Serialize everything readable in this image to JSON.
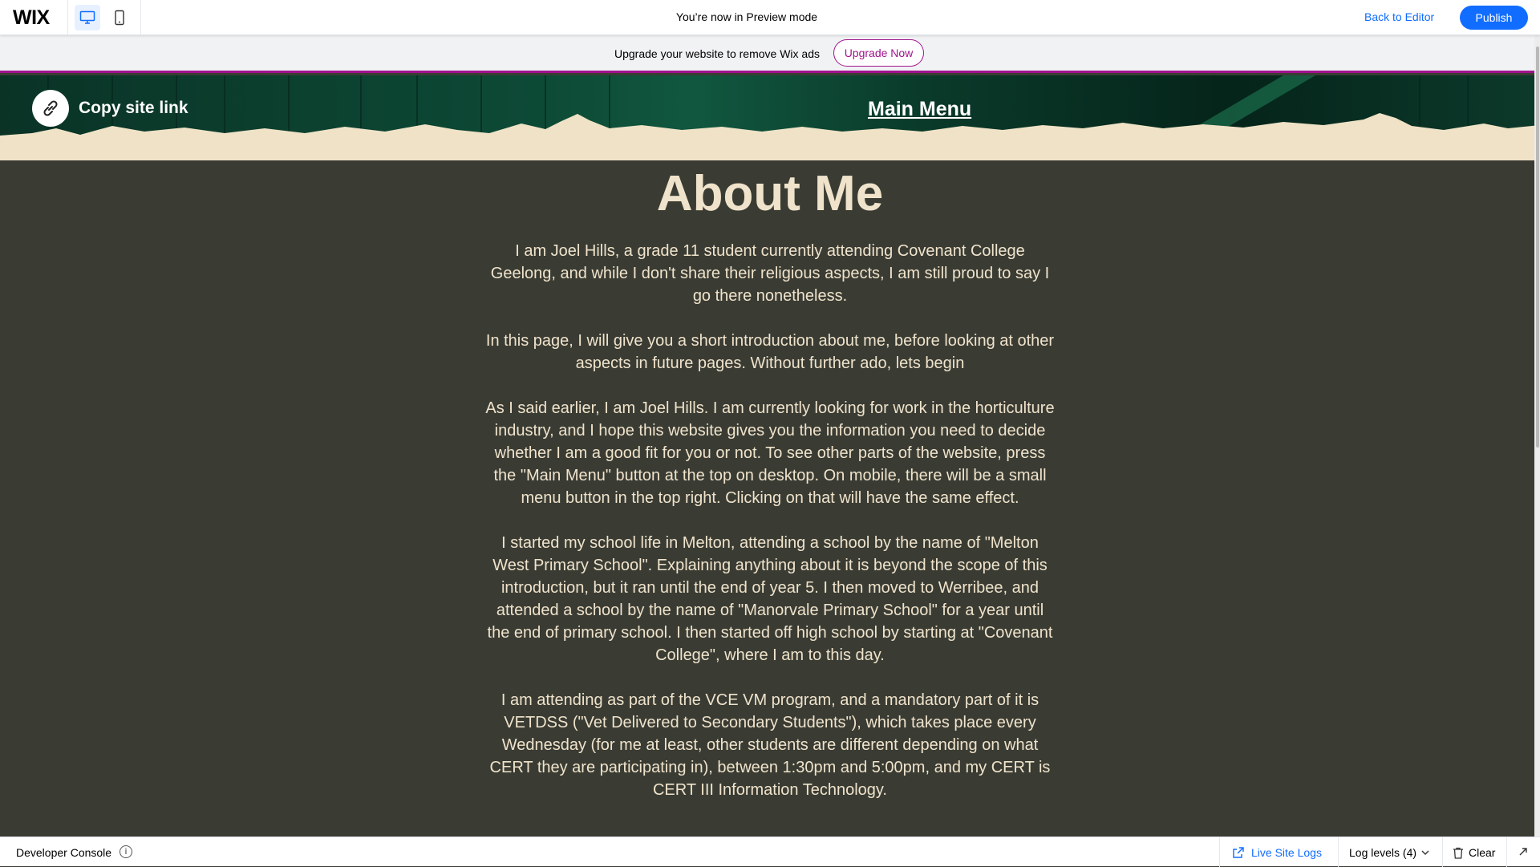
{
  "topbar": {
    "logo": "WIX",
    "preview_label": "You’re now in Preview mode",
    "back_to_editor": "Back to Editor",
    "publish": "Publish",
    "desktop_icon": "desktop-icon",
    "mobile_icon": "mobile-icon"
  },
  "upgrade": {
    "text": "Upgrade your website to remove Wix ads",
    "button": "Upgrade Now"
  },
  "site_header": {
    "copy_link": "Copy site link",
    "main_menu": "Main Menu"
  },
  "content": {
    "title": "About Me",
    "paragraphs": [
      "I am Joel Hills, a grade 11 student currently attending Covenant College Geelong, and while I don't share their religious aspects, I am still proud to say I go there nonetheless.",
      "In this page, I will give you a short introduction about me, before looking at other aspects in future pages. Without further ado, lets begin",
      "As I said earlier, I am Joel Hills. I am currently looking for work in the horticulture industry, and I hope this website gives you the information you need to decide whether I am a good fit for you or not. To see other parts of the website, press the \"Main Menu\" button at the top on desktop. On mobile, there will be a small menu button in the top right. Clicking on that will have the same effect.",
      "I started my school life in Melton, attending a school by the name of \"Melton West Primary School\". Explaining anything about it is beyond the scope of this introduction, but it ran until the end of year 5. I then moved to Werribee, and attended a school by the name of \"Manorvale Primary School\" for a year until the end of primary school. I then started off high school by starting at \"Covenant College\", where I am to this day.",
      "I am attending as part of the VCE VM program, and a mandatory part of it is VETDSS (\"Vet Delivered to Secondary Students\"), which takes place every Wednesday (for me at least, other students are different depending on what CERT they are participating in), between 1:30pm and 5:00pm, and my CERT is CERT III Information Technology."
    ]
  },
  "devconsole": {
    "title": "Developer Console",
    "info_icon": "info-icon",
    "live_site_logs": "Live Site Logs",
    "log_levels": "Log levels (4)",
    "clear": "Clear"
  },
  "colors": {
    "wix_blue": "#116dff",
    "upgrade_purple": "#a0138e",
    "page_bg": "#3a3c34",
    "text_cream": "#f0e3cb",
    "header_green": "#0b3b2c"
  }
}
